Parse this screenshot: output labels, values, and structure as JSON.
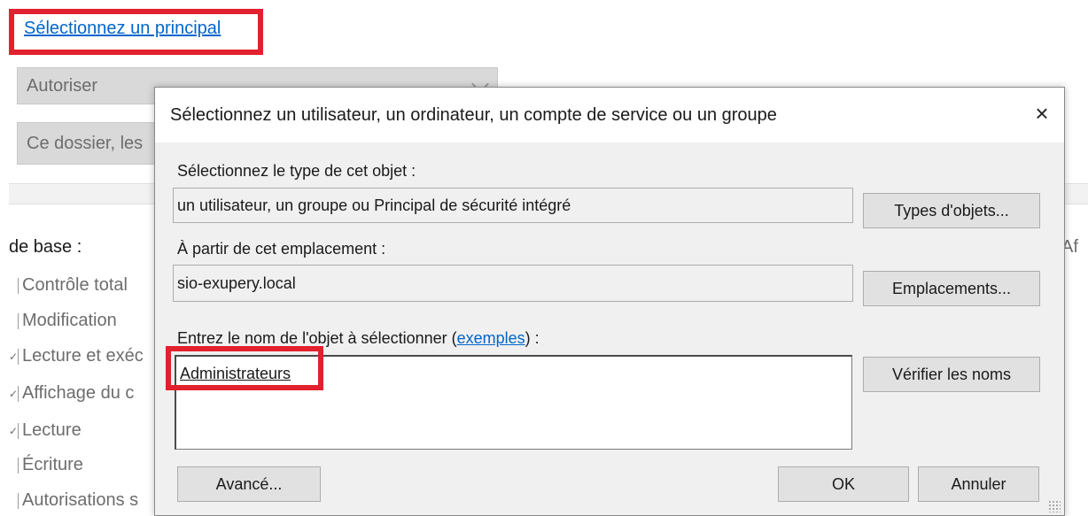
{
  "background": {
    "principal_link": "Sélectionnez un principal",
    "type_select": "Autoriser",
    "apply_select": "Ce dossier, les",
    "basic_heading": "de base :",
    "right_fragment": "Af",
    "permissions": [
      {
        "mark": "",
        "label": "Contrôle total"
      },
      {
        "mark": "",
        "label": "Modification"
      },
      {
        "mark": "✓",
        "label": "Lecture et exéc"
      },
      {
        "mark": "✓",
        "label": "Affichage du c"
      },
      {
        "mark": "✓",
        "label": "Lecture"
      },
      {
        "mark": "",
        "label": "Écriture"
      },
      {
        "mark": "",
        "label": "Autorisations s"
      }
    ]
  },
  "dialog": {
    "title": "Sélectionnez un utilisateur, un ordinateur, un compte de service ou un groupe",
    "close_icon": "×",
    "object_type_label": "Sélectionnez le type de cet objet :",
    "object_type_value": "un utilisateur, un groupe ou Principal de sécurité intégré",
    "object_types_button": "Types d'objets...",
    "location_label": "À partir de cet emplacement :",
    "location_value": "sio-exupery.local",
    "locations_button": "Emplacements...",
    "name_label_prefix": "Entrez le nom de l'objet à sélectionner (",
    "examples_link": "exemples",
    "name_label_suffix": ") :",
    "name_value": "Administrateurs",
    "check_names_button": "Vérifier les noms",
    "advanced_button": "Avancé...",
    "ok_button": "OK",
    "cancel_button": "Annuler"
  },
  "colors": {
    "highlight": "#e3202d",
    "link": "#0066cc",
    "dialog_bg": "#f0f0f0"
  }
}
